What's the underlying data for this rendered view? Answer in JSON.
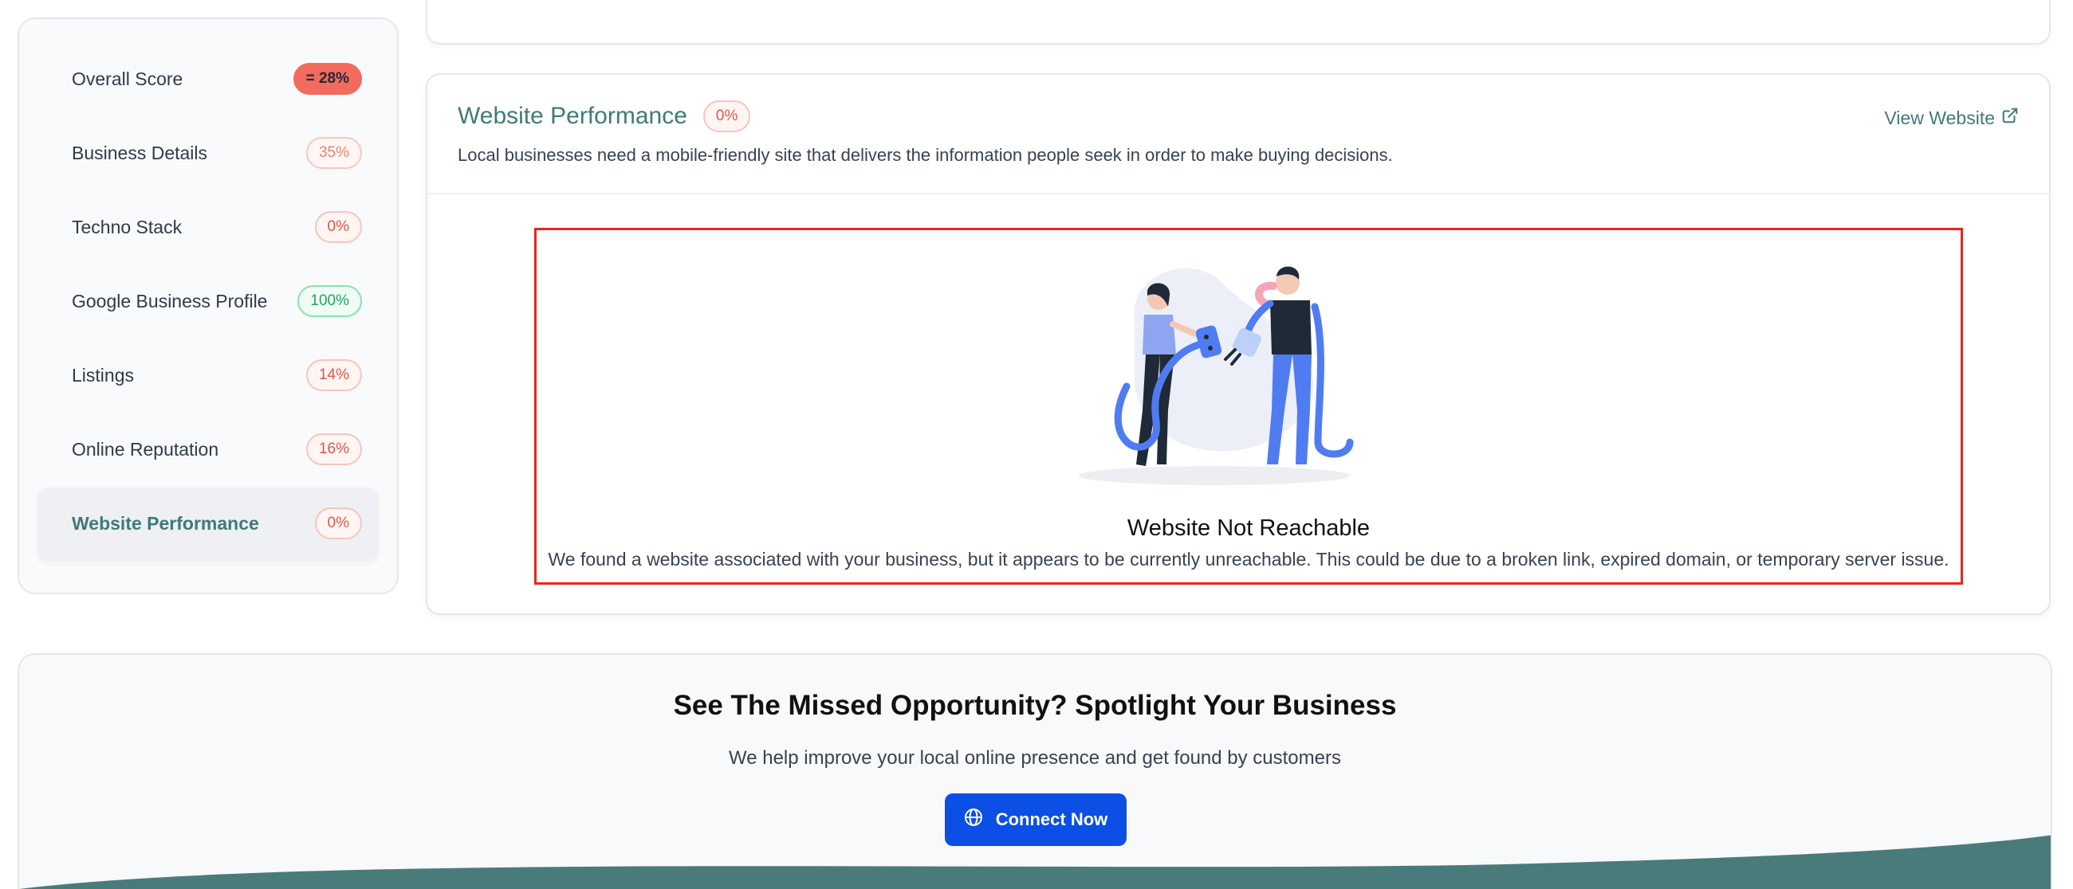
{
  "sidebar": {
    "items": [
      {
        "label": "Overall Score",
        "score": "= 28%"
      },
      {
        "label": "Business Details",
        "score": "35%"
      },
      {
        "label": "Techno Stack",
        "score": "0%"
      },
      {
        "label": "Google Business Profile",
        "score": "100%"
      },
      {
        "label": "Listings",
        "score": "14%"
      },
      {
        "label": "Online Reputation",
        "score": "16%"
      },
      {
        "label": "Website Performance",
        "score": "0%"
      }
    ]
  },
  "section": {
    "title": "Website Performance",
    "score": "0%",
    "description": "Local businesses need a mobile-friendly site that delivers the information people seek in order to make buying decisions.",
    "view_link": "View Website",
    "alert_title": "Website Not Reachable",
    "alert_text": "We found a website associated with your business, but it appears to be currently unreachable. This could be due to a broken link, expired domain, or temporary server issue."
  },
  "cta": {
    "title": "See The Missed Opportunity? Spotlight Your Business",
    "subtitle": "We help improve your local online presence and get found by customers",
    "button_label": "Connect Now",
    "button_icon": "globe-icon"
  },
  "colors": {
    "accent": "#3f7a78",
    "danger": "#e8261c",
    "primary_button": "#0b4fe5",
    "wave": "#4a7b7b"
  }
}
